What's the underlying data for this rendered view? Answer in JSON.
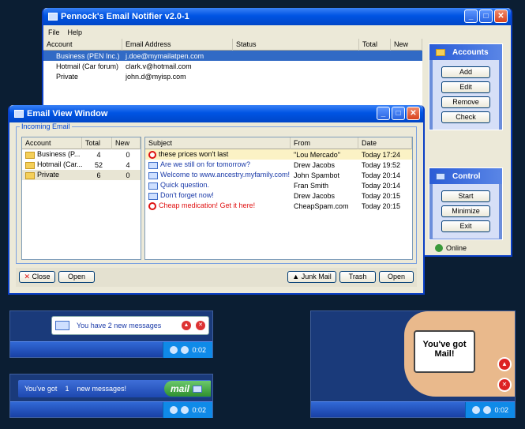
{
  "main_window": {
    "title": "Pennock's Email Notifier v2.0-1",
    "menu": [
      "File",
      "Help"
    ],
    "columns": [
      "Account",
      "Email Address",
      "Status",
      "Total",
      "New"
    ],
    "rows": [
      {
        "account": "Business (PEN Inc.)",
        "email": "j.doe@mymailatpen.com",
        "selected": true
      },
      {
        "account": "Hotmail (Car forum)",
        "email": "clark.v@hotmail.com",
        "selected": false
      },
      {
        "account": "Private",
        "email": "john.d@myisp.com",
        "selected": false
      }
    ]
  },
  "accounts_panel": {
    "title": "Accounts",
    "buttons": [
      "Add",
      "Edit",
      "Remove",
      "Check"
    ]
  },
  "control_panel": {
    "title": "Control",
    "buttons": [
      "Start",
      "Minimize",
      "Exit"
    ],
    "status": "Online"
  },
  "view_window": {
    "title": "Email View Window",
    "group_label": "Incoming Email",
    "account_columns": [
      "Account",
      "Total",
      "New"
    ],
    "accounts": [
      {
        "name": "Business (P...",
        "total": "4",
        "new": "0"
      },
      {
        "name": "Hotmail (Car...",
        "total": "52",
        "new": "4"
      },
      {
        "name": "Private",
        "total": "6",
        "new": "0"
      }
    ],
    "mail_columns": [
      "Subject",
      "From",
      "Date"
    ],
    "mails": [
      {
        "subject": "these prices won't last",
        "from": "\"Lou Mercado\"",
        "date": "Today 17:24",
        "spam": true
      },
      {
        "subject": "Are we still on for tomorrow?",
        "from": "Drew Jacobs",
        "date": "Today 19:52",
        "spam": false
      },
      {
        "subject": "Welcome to www.ancestry.myfamily.com!",
        "from": "John Spambot",
        "date": "Today 20:14",
        "spam": false
      },
      {
        "subject": "Quick question.",
        "from": "Fran Smith",
        "date": "Today 20:14",
        "spam": false
      },
      {
        "subject": "Don't forget now!",
        "from": "Drew Jacobs",
        "date": "Today 20:15",
        "spam": false
      },
      {
        "subject": "Cheap medication! Get it here!",
        "from": "CheapSpam.com",
        "date": "Today 20:15",
        "spam": true
      }
    ],
    "buttons": {
      "close": "Close",
      "open_left": "Open",
      "junk": "Junk Mail",
      "trash": "Trash",
      "open_right": "Open"
    }
  },
  "notify1": {
    "text": "You have 2 new messages",
    "clock": "0:02"
  },
  "notify2": {
    "prefix": "You've got",
    "count": "1",
    "suffix": "new messages!",
    "badge": "mail",
    "clock": "0:02"
  },
  "notify3": {
    "line1": "You've got",
    "line2": "Mail!",
    "clock": "0:02"
  }
}
